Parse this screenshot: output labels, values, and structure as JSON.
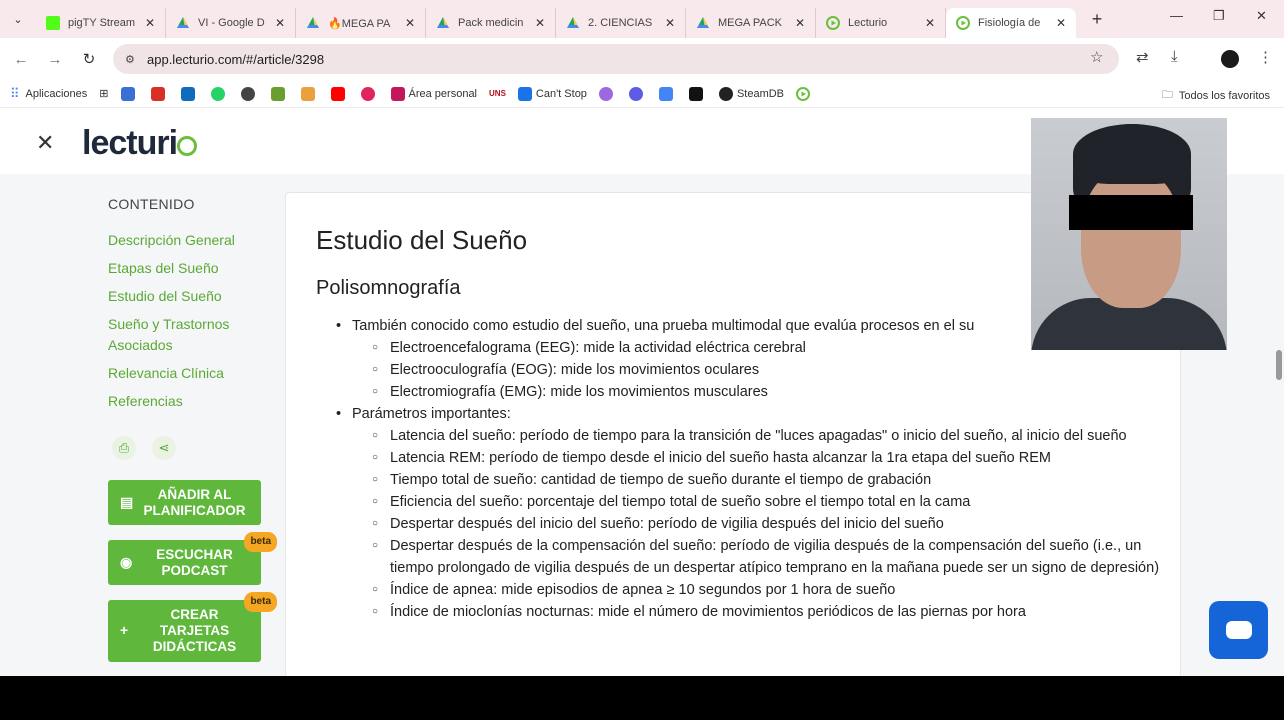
{
  "browser": {
    "tabs": [
      {
        "title": "pigTY Stream",
        "icon": "kick-icon",
        "color": "#53fc18",
        "active": false
      },
      {
        "title": "VI - Google D",
        "icon": "drive-icon",
        "color": "#1fa463",
        "active": false
      },
      {
        "title": "🔥MEGA PA",
        "icon": "drive-icon",
        "color": "#1fa463",
        "active": false
      },
      {
        "title": "Pack medicin",
        "icon": "drive-icon",
        "color": "#1fa463",
        "active": false
      },
      {
        "title": "2. CIENCIAS",
        "icon": "drive-icon",
        "color": "#1fa463",
        "active": false
      },
      {
        "title": "MEGA PACK",
        "icon": "drive-icon",
        "color": "#1fa463",
        "active": false
      },
      {
        "title": "Lecturio",
        "icon": "lecturio-icon",
        "color": "#6bbf3a",
        "active": false
      },
      {
        "title": "Fisiología de",
        "icon": "lecturio-icon",
        "color": "#6bbf3a",
        "active": true
      }
    ],
    "url": "app.lecturio.com/#/article/3298",
    "bookmarks": {
      "apps_label": "Aplicaciones",
      "items": [
        "Área personal",
        "Can't Stop",
        "SteamDB"
      ],
      "all_label": "Todos los favoritos"
    }
  },
  "header": {
    "logo_text": "lecturio"
  },
  "sidebar": {
    "heading": "CONTENIDO",
    "items": [
      "Descripción General",
      "Etapas del Sueño",
      "Estudio del Sueño",
      "Sueño y Trastornos Asociados",
      "Relevancia Clínica",
      "Referencias"
    ],
    "buttons": [
      {
        "label": "AÑADIR AL PLANIFICADOR",
        "badge": ""
      },
      {
        "label": "ESCUCHAR PODCAST",
        "badge": "beta"
      },
      {
        "label": "CREAR TARJETAS DIDÁCTICAS",
        "badge": "beta"
      }
    ]
  },
  "article": {
    "title": "Estudio del Sueño",
    "subtitle": "Polisomnografía",
    "bullet1": "También conocido como estudio del sueño, una prueba multimodal que evalúa procesos en el su",
    "bullet1_items": [
      "Electroencefalograma (EEG): mide la actividad eléctrica cerebral",
      "Electrooculografía (EOG): mide los movimientos oculares",
      "Electromiografía (EMG): mide los movimientos musculares"
    ],
    "bullet2": "Parámetros importantes:",
    "bullet2_items": [
      "Latencia del sueño: período de tiempo para la transición de \"luces apagadas\" o inicio del sueño, al inicio del sueño",
      "Latencia REM: período de tiempo desde el inicio del sueño hasta alcanzar la 1ra etapa del sueño REM",
      "Tiempo total de sueño: cantidad de tiempo de sueño durante el tiempo de grabación",
      "Eficiencia del sueño: porcentaje del tiempo total de sueño sobre el tiempo total en la cama",
      "Despertar después del inicio del sueño: período de vigilia después del inicio del sueño",
      "Despertar después de la compensación del sueño: período de vigilia después de la compensación del sueño (i.e., un tiempo prolongado de vigilia después de un despertar atípico temprano en la mañana puede ser un signo de depresión)",
      "Índice de apnea: mide episodios de apnea ≥ 10 segundos por 1 hora de sueño",
      "Índice de mioclonías nocturnas: mide el número de movimientos periódicos de las piernas por hora"
    ]
  },
  "colors": {
    "accent_green": "#5fb83c",
    "link_green": "#5ba935",
    "beta_badge": "#f5a623",
    "chat_blue": "#1565d8"
  }
}
